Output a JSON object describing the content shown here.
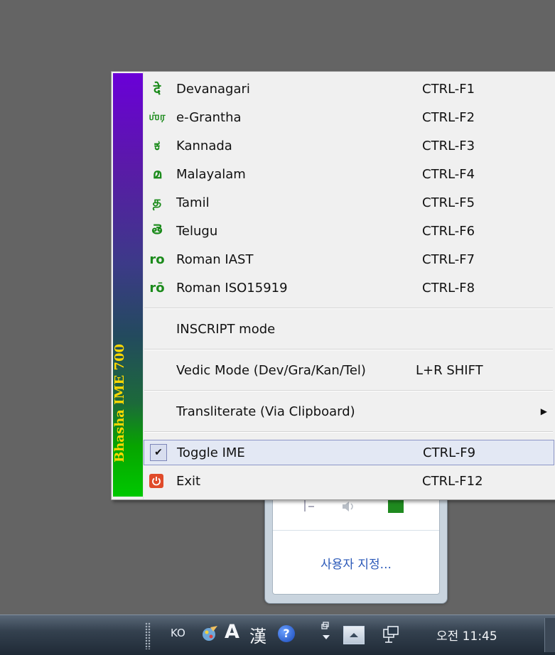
{
  "menu": {
    "banner": "Bhasha IME 700",
    "scripts": [
      {
        "icon_glyph": "दे",
        "icon": "devanagari-script-icon",
        "label": "Devanagari",
        "shortcut": "CTRL-F1"
      },
      {
        "icon_glyph": "ஶ்ர",
        "icon": "grantha-script-icon",
        "label": "e-Grantha",
        "shortcut": "CTRL-F2"
      },
      {
        "icon_glyph": "ಕ",
        "icon": "kannada-script-icon",
        "label": "Kannada",
        "shortcut": "CTRL-F3"
      },
      {
        "icon_glyph": "മ",
        "icon": "malayalam-script-icon",
        "label": "Malayalam",
        "shortcut": "CTRL-F4"
      },
      {
        "icon_glyph": "த",
        "icon": "tamil-script-icon",
        "label": "Tamil",
        "shortcut": "CTRL-F5"
      },
      {
        "icon_glyph": "తె",
        "icon": "telugu-script-icon",
        "label": "Telugu",
        "shortcut": "CTRL-F6"
      },
      {
        "icon_glyph": "ro",
        "icon": "roman-iast-icon",
        "label": "Roman IAST",
        "shortcut": "CTRL-F7"
      },
      {
        "icon_glyph": "rō",
        "icon": "roman-iso-icon",
        "label": "Roman ISO15919",
        "shortcut": "CTRL-F8"
      }
    ],
    "inscript": {
      "label": "INSCRIPT mode"
    },
    "vedic": {
      "label": "Vedic Mode (Dev/Gra/Kan/Tel)",
      "shortcut": "L+R SHIFT"
    },
    "transliterate": {
      "label": "Transliterate (Via Clipboard)",
      "submenu_glyph": "▶"
    },
    "toggle": {
      "check_glyph": "✔",
      "label": "Toggle IME",
      "shortcut": "CTRL-F9"
    },
    "exit": {
      "label": "Exit",
      "shortcut": "CTRL-F12"
    }
  },
  "tray_flyout": {
    "customize_link": "사용자 지정..."
  },
  "taskbar": {
    "ime_lang": "KO",
    "ime_mode": "A",
    "ime_hanja": "漢",
    "help_glyph": "?",
    "clock": "오전 11:45"
  },
  "colors": {
    "banner_top": "#6a00d8",
    "banner_bottom": "#00c800",
    "banner_text": "#ffd800",
    "script_icon": "#1a8a1a",
    "selection_border": "#8d96c8",
    "exit_icon": "#e04b2a"
  }
}
